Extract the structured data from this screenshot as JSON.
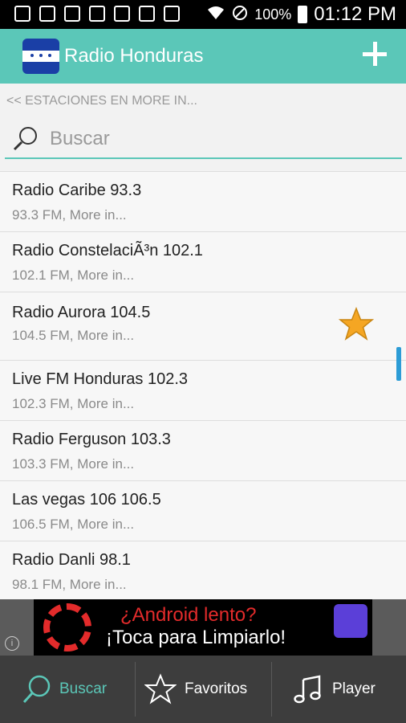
{
  "status_bar": {
    "battery": "100%",
    "time": "01:12 PM"
  },
  "app_bar": {
    "title": "Radio Honduras"
  },
  "breadcrumb": "<< ESTACIONES EN MORE IN...",
  "search": {
    "placeholder": "Buscar"
  },
  "stations": [
    {
      "name": "Radio Caribe 93.3",
      "sub": "93.3 FM, More in...",
      "favorite": false
    },
    {
      "name": "Radio ConstelaciÃ³n 102.1",
      "sub": "102.1 FM, More in...",
      "favorite": false
    },
    {
      "name": "Radio Aurora 104.5",
      "sub": "104.5 FM, More in...",
      "favorite": true
    },
    {
      "name": "Live FM Honduras 102.3",
      "sub": "102.3 FM, More in...",
      "favorite": false
    },
    {
      "name": "Radio Ferguson 103.3",
      "sub": "103.3 FM, More in...",
      "favorite": false
    },
    {
      "name": "Las vegas 106 106.5",
      "sub": "106.5 FM, More in...",
      "favorite": false
    },
    {
      "name": "Radio Danli 98.1",
      "sub": "98.1 FM, More in...",
      "favorite": false
    }
  ],
  "ad": {
    "line1": "¿Android lento?",
    "line2": "¡Toca para Limpiarlo!"
  },
  "tabs": [
    {
      "label": "Buscar",
      "icon": "search-icon",
      "active": true
    },
    {
      "label": "Favoritos",
      "icon": "star-icon",
      "active": false
    },
    {
      "label": "Player",
      "icon": "music-note-icon",
      "active": false
    }
  ],
  "colors": {
    "accent": "#5bc7b8",
    "scrollbar": "#2c9cd6",
    "favorite_star": "#f5a623"
  }
}
